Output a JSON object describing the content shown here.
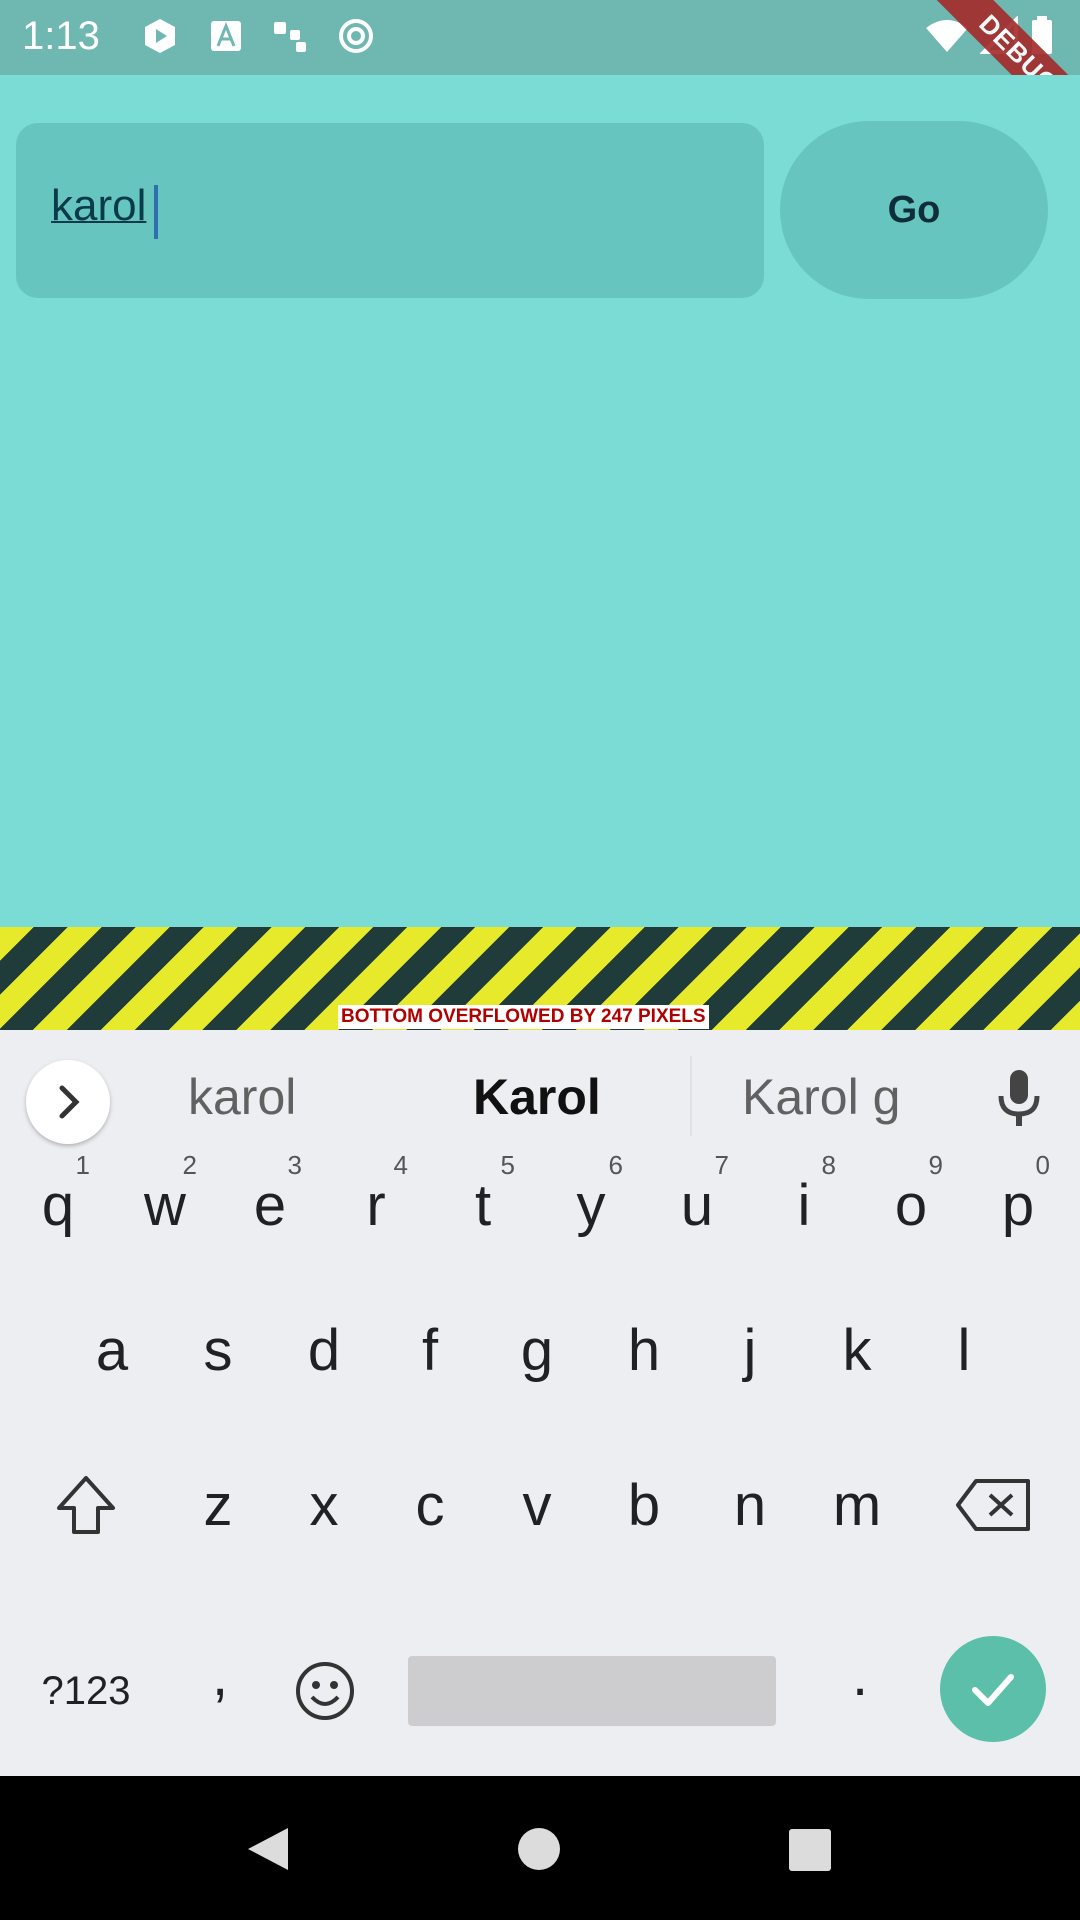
{
  "status_bar": {
    "time": "1:13",
    "left_icons": [
      "play-store-icon",
      "font-icon",
      "dots-icon",
      "sync-icon"
    ],
    "right_icons": [
      "wifi-icon",
      "cell-signal-icon",
      "battery-icon"
    ],
    "debug_banner": "DEBUG"
  },
  "app": {
    "text_field": {
      "value": "karol"
    },
    "go_button": {
      "label": "Go"
    },
    "overflow_message": "BOTTOM OVERFLOWED BY 247 PIXELS",
    "colors": {
      "background": "#7adcd4",
      "field": "#66c6bf"
    }
  },
  "keyboard": {
    "suggestions": [
      "karol",
      "Karol",
      "Karol g"
    ],
    "row1": [
      {
        "key": "q",
        "hint": "1"
      },
      {
        "key": "w",
        "hint": "2"
      },
      {
        "key": "e",
        "hint": "3"
      },
      {
        "key": "r",
        "hint": "4"
      },
      {
        "key": "t",
        "hint": "5"
      },
      {
        "key": "y",
        "hint": "6"
      },
      {
        "key": "u",
        "hint": "7"
      },
      {
        "key": "i",
        "hint": "8"
      },
      {
        "key": "o",
        "hint": "9"
      },
      {
        "key": "p",
        "hint": "0"
      }
    ],
    "row2": [
      "a",
      "s",
      "d",
      "f",
      "g",
      "h",
      "j",
      "k",
      "l"
    ],
    "row3": [
      "z",
      "x",
      "c",
      "v",
      "b",
      "n",
      "m"
    ],
    "symbols_label": "?123",
    "comma_label": ",",
    "period_label": ".",
    "enter_color": "#5bbfa9"
  },
  "nav_bar": {
    "icons": [
      "back-icon",
      "home-icon",
      "recents-icon"
    ]
  }
}
